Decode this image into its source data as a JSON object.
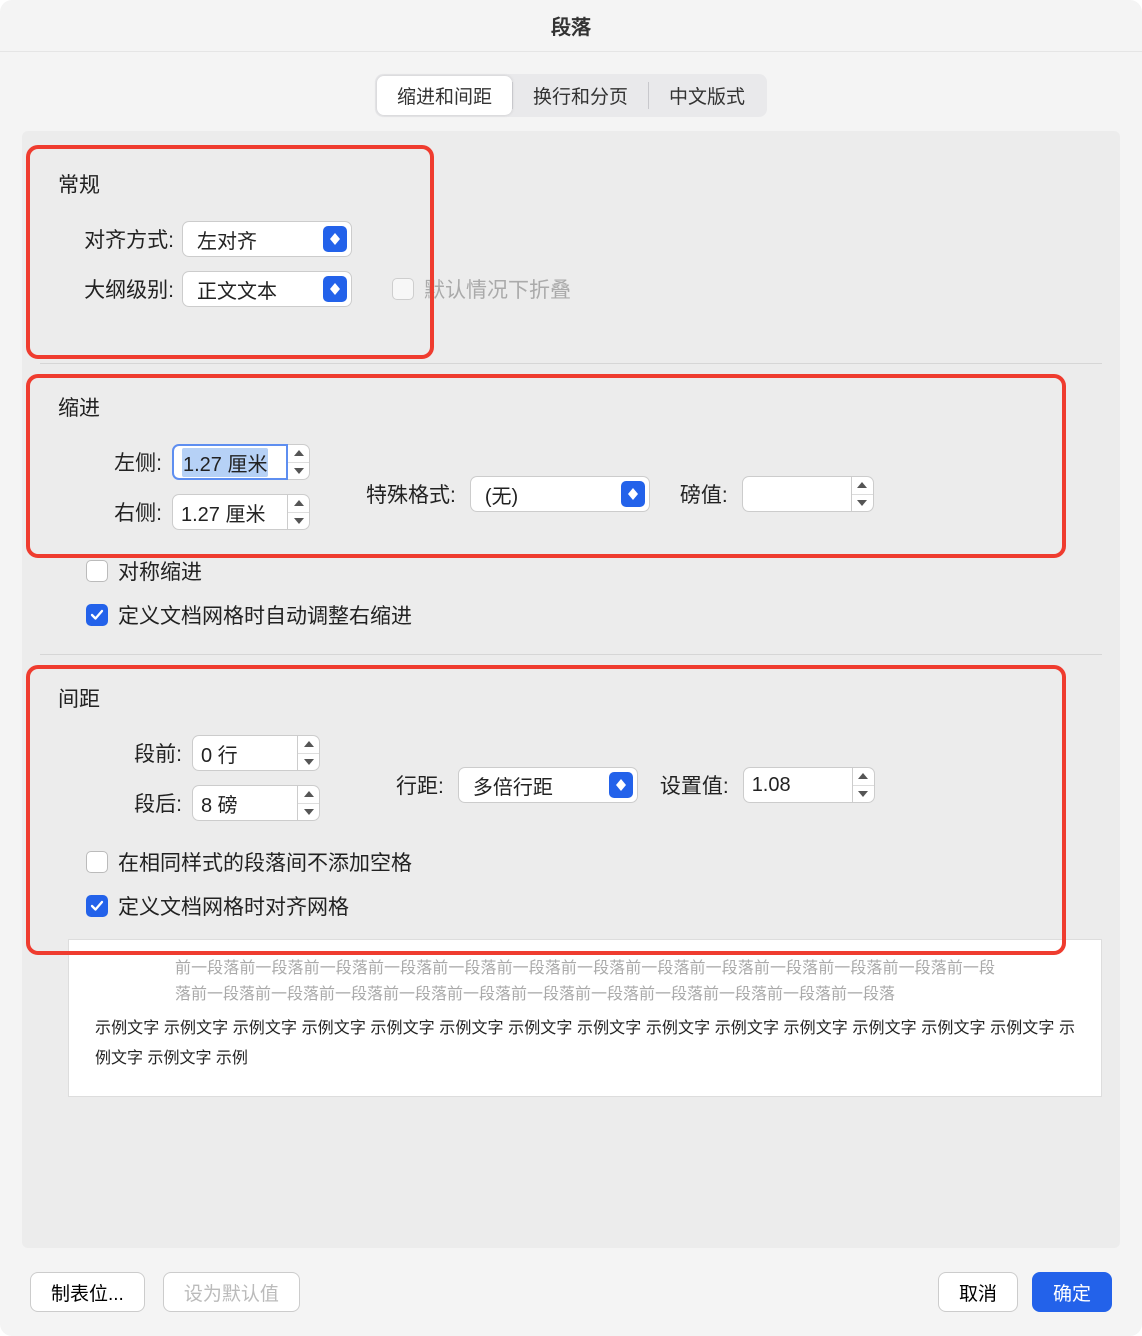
{
  "title": "段落",
  "tabs": {
    "indent_spacing": "缩进和间距",
    "line_page": "换行和分页",
    "chinese": "中文版式"
  },
  "general": {
    "title": "常规",
    "alignment_label": "对齐方式:",
    "alignment_value": "左对齐",
    "outline_label": "大纲级别:",
    "outline_value": "正文文本",
    "collapse_label": "默认情况下折叠"
  },
  "indent": {
    "title": "缩进",
    "left_label": "左侧:",
    "left_value": "1.27 厘米",
    "right_label": "右侧:",
    "right_value": "1.27 厘米",
    "special_label": "特殊格式:",
    "special_value": "(无)",
    "by_label": "磅值:",
    "by_value": "",
    "mirror_label": "对称缩进",
    "auto_adjust_label": "定义文档网格时自动调整右缩进"
  },
  "spacing": {
    "title": "间距",
    "before_label": "段前:",
    "before_value": "0 行",
    "after_label": "段后:",
    "after_value": "8 磅",
    "line_spacing_label": "行距:",
    "line_spacing_value": "多倍行距",
    "at_label": "设置值:",
    "at_value": "1.08",
    "no_space_label": "在相同样式的段落间不添加空格",
    "snap_grid_label": "定义文档网格时对齐网格"
  },
  "preview": {
    "grey": "前一段落前一段落前一段落前一段落前一段落前一段落前一段落前一段落前一段落前一段落前一段落前一段落前一段落前一段落前一段落前一段落前一段落前一段落前一段落前一段落前一段落前一段落前一段落前一段落",
    "black": "示例文字 示例文字 示例文字 示例文字 示例文字 示例文字 示例文字 示例文字 示例文字 示例文字 示例文字 示例文字 示例文字 示例文字 示例文字 示例文字 示例"
  },
  "buttons": {
    "tabs": "制表位...",
    "default": "设为默认值",
    "cancel": "取消",
    "ok": "确定"
  }
}
